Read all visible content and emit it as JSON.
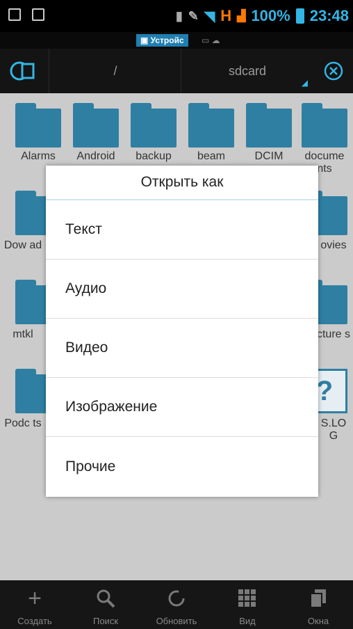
{
  "status": {
    "battery": "100%",
    "time": "23:48",
    "signal": "H"
  },
  "subtab": {
    "label": "Устройс"
  },
  "path": {
    "root": "/",
    "current": "sdcard"
  },
  "folders": [
    {
      "label": "Alarms"
    },
    {
      "label": "Android"
    },
    {
      "label": "backup"
    },
    {
      "label": "beam"
    },
    {
      "label": "DCIM"
    },
    {
      "label": "docume nts"
    },
    {
      "label": "Dow ad"
    },
    {
      "label": "ovies"
    },
    {
      "label": "mtkl"
    },
    {
      "label": "cture s"
    },
    {
      "label": "Podc ts"
    },
    {
      "label": "S.LO G"
    }
  ],
  "dialog": {
    "title": "Открыть как",
    "items": [
      {
        "label": "Текст"
      },
      {
        "label": "Аудио"
      },
      {
        "label": "Видео"
      },
      {
        "label": "Изображение"
      },
      {
        "label": "Прочие"
      }
    ]
  },
  "toolbar": [
    {
      "label": "Создать",
      "icon": "plus-icon"
    },
    {
      "label": "Поиск",
      "icon": "search-icon"
    },
    {
      "label": "Обновить",
      "icon": "refresh-icon"
    },
    {
      "label": "Вид",
      "icon": "grid-view-icon"
    },
    {
      "label": "Окна",
      "icon": "windows-icon"
    }
  ],
  "colors": {
    "accent": "#33b5e5",
    "folder": "#2f7fa3"
  }
}
